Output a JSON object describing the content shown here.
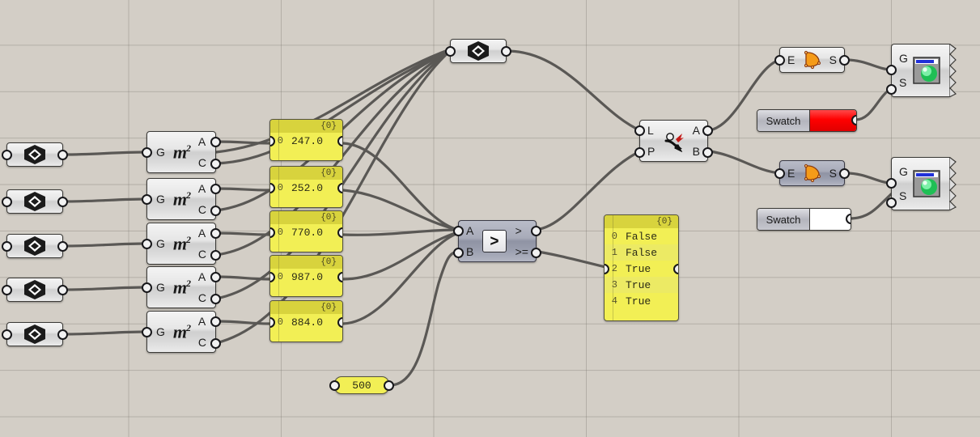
{
  "canvas": {
    "background_color": "#d3cec6",
    "grid_color": "#78746c",
    "wire_color": "#5a5855"
  },
  "geometry_params": [
    {
      "name": "geometry-param-1",
      "icon": "geometry-diamond-icon"
    },
    {
      "name": "geometry-param-2",
      "icon": "geometry-diamond-icon"
    },
    {
      "name": "geometry-param-3",
      "icon": "geometry-diamond-icon"
    },
    {
      "name": "geometry-param-4",
      "icon": "geometry-diamond-icon"
    },
    {
      "name": "geometry-param-5",
      "icon": "geometry-diamond-icon"
    },
    {
      "name": "geometry-param-merge",
      "icon": "geometry-diamond-icon"
    }
  ],
  "area_components": {
    "input_label": "G",
    "output_a": "A",
    "output_c": "C",
    "icon_text": "m",
    "icon_sup": "2",
    "count": 5
  },
  "value_panels": [
    {
      "header": "{0}",
      "index": "0",
      "value": "247.0"
    },
    {
      "header": "{0}",
      "index": "0",
      "value": "252.0"
    },
    {
      "header": "{0}",
      "index": "0",
      "value": "770.0"
    },
    {
      "header": "{0}",
      "index": "0",
      "value": "987.0"
    },
    {
      "header": "{0}",
      "index": "0",
      "value": "884.0"
    }
  ],
  "number_node": {
    "value": "500"
  },
  "comparison": {
    "input_a": "A",
    "input_b": "B",
    "badge": ">",
    "output_gt": ">",
    "output_gte": ">="
  },
  "boolean_panel": {
    "header": "{0}",
    "rows": [
      {
        "index": "0",
        "value": "False"
      },
      {
        "index": "1",
        "value": "False"
      },
      {
        "index": "2",
        "value": "True"
      },
      {
        "index": "3",
        "value": "True"
      },
      {
        "index": "4",
        "value": "True"
      }
    ]
  },
  "dispatch": {
    "input_l": "L",
    "input_p": "P",
    "output_a": "A",
    "output_b": "B",
    "icon": "dispatch-arrow-icon"
  },
  "surface_nodes": [
    {
      "name": "surface-node-top",
      "input": "E",
      "output": "S",
      "icon": "surface-orange-icon"
    },
    {
      "name": "surface-node-bottom",
      "input": "E",
      "output": "S",
      "icon": "surface-orange-icon"
    }
  ],
  "swatches": [
    {
      "label": "Swatch",
      "color": "#ff0000"
    },
    {
      "label": "Swatch",
      "color": "#ffffff"
    }
  ],
  "preview_nodes": [
    {
      "name": "custom-preview-top",
      "input_g": "G",
      "input_s": "S",
      "icon": "preview-sphere-icon"
    },
    {
      "name": "custom-preview-bottom",
      "input_g": "G",
      "input_s": "S",
      "icon": "preview-sphere-icon"
    }
  ]
}
